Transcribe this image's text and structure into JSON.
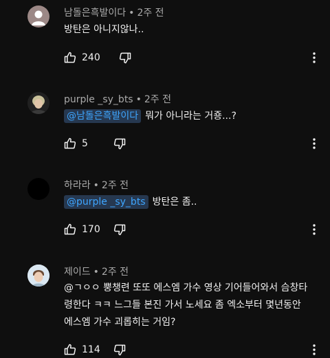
{
  "comments": [
    {
      "author": "남돌은흑발이다",
      "time": "2주 전",
      "mention": "",
      "text": "방탄은 아니지않나..",
      "likes": "240",
      "avatar_icon": "default-avatar-icon"
    },
    {
      "author": "purple _sy_bts",
      "time": "2주 전",
      "mention": "@남돌은흑발이다",
      "text": "뭐가 아니라는 거죵...?",
      "likes": "5",
      "avatar_icon": "profile-photo-avatar"
    },
    {
      "author": "하라라",
      "time": "2주 전",
      "mention": "@purple _sy_bts",
      "text": "방탄은 좀..",
      "likes": "170",
      "avatar_icon": "black-avatar"
    },
    {
      "author": "제이드",
      "time": "2주 전",
      "mention": "",
      "text": "@ㄱㅇㅇ  뿡챙련 또또 에스엠 가수 영상 기어들어와서 슴창타령한다 ㅋㅋ 느그들 본진 가서 노세요 좀 엑소부터 몇년동안 에스엠 가수 괴롭히는 거임?",
      "likes": "114",
      "avatar_icon": "profile-photo-avatar"
    }
  ],
  "colors": {
    "background": "#0f0f0f",
    "mention_text": "#3ea6ff",
    "mention_bg": "#263850",
    "secondary_text": "#aaaaaa"
  },
  "separator": "•"
}
